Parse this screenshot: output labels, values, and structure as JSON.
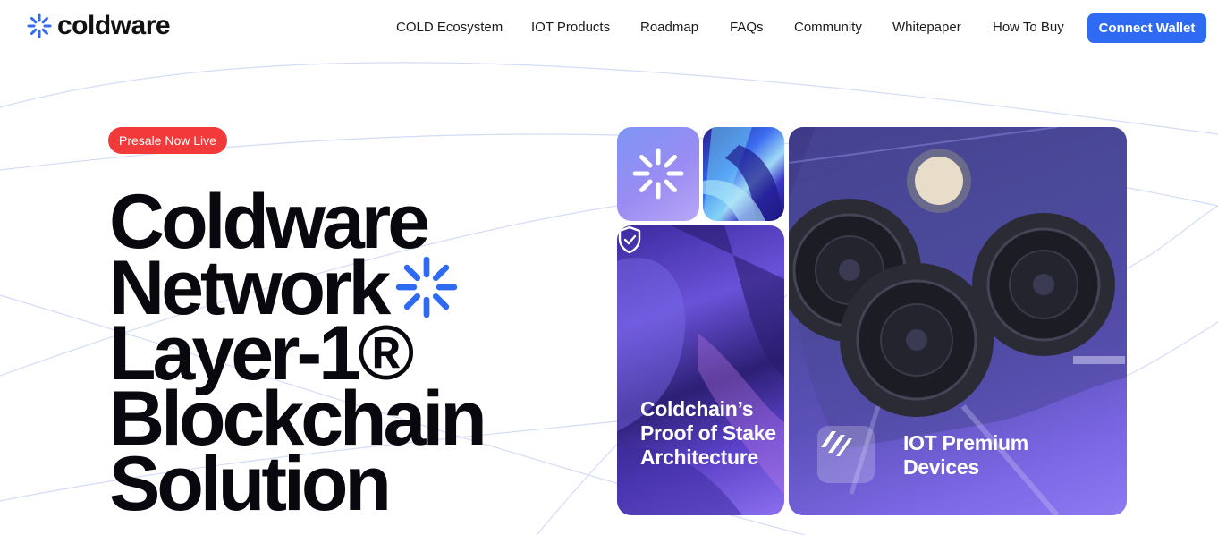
{
  "header": {
    "logo_text": "coldware",
    "nav": [
      {
        "label": "COLD Ecosystem"
      },
      {
        "label": "IOT Products"
      },
      {
        "label": "Roadmap"
      },
      {
        "label": "FAQs"
      },
      {
        "label": "Community"
      },
      {
        "label": "Whitepaper"
      },
      {
        "label": "How To Buy"
      }
    ],
    "connect_label": "Connect Wallet"
  },
  "hero": {
    "badge": "Presale Now Live",
    "title_lines": [
      "Coldware",
      "Network",
      "Layer-1®",
      "Blockchain",
      "Solution"
    ]
  },
  "tiles": {
    "pos_caption": "Coldchain’s Proof of Stake Architecture",
    "iot_caption": "IOT Premium Devices"
  },
  "colors": {
    "brand_blue": "#2f6af2",
    "badge_red": "#f23a3a",
    "star_blue": "#2f6af2"
  },
  "icons": {
    "logo": "asterisk-star-icon",
    "title_star": "asterisk-star-icon",
    "shield": "shield-check-icon",
    "iot": "coldware-stripes-icon"
  }
}
